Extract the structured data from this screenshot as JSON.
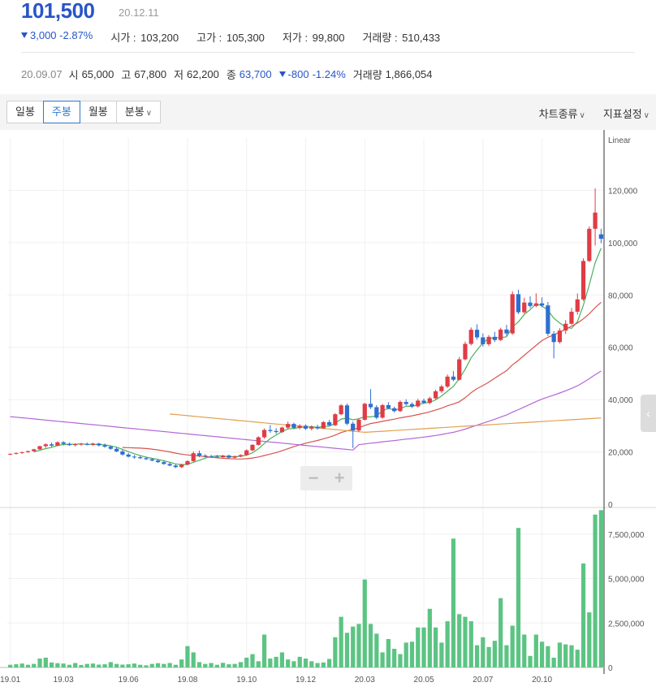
{
  "header": {
    "price": "101,500",
    "date": "20.12.11",
    "change": "3,000",
    "change_pct": "-2.87%",
    "open_label": "시가",
    "open": "103,200",
    "high_label": "고가",
    "high": "105,300",
    "low_label": "저가",
    "low": "99,800",
    "volume_label": "거래량",
    "volume": "510,433"
  },
  "hover": {
    "date": "20.09.07",
    "open_label": "시",
    "open": "65,000",
    "high_label": "고",
    "high": "67,800",
    "low_label": "저",
    "low": "62,200",
    "close_label": "종",
    "close": "63,700",
    "change": "-800",
    "change_pct": "-1.24%",
    "volume_label": "거래량",
    "volume": "1,866,054"
  },
  "toolbar": {
    "tabs": [
      "일봉",
      "주봉",
      "월봉",
      "분봉"
    ],
    "active_tab": "주봉",
    "chart_type_label": "차트종류",
    "indicator_label": "지표설정"
  },
  "colors": {
    "up": "#e03c45",
    "down": "#2e6fd0",
    "volume": "#5cc483",
    "ma5": "#4cb05a",
    "ma20": "#d9534f",
    "ma60": "#b466d6",
    "ma120": "#e0a050",
    "price_blue": "#2855c7"
  },
  "chart_data": {
    "type": "candlestick",
    "scale_label": "Linear",
    "price_axis": {
      "ticks": [
        "120,000",
        "100,000",
        "80,000",
        "60,000",
        "40,000",
        "20,000",
        "0"
      ],
      "ylim": [
        0,
        140000
      ]
    },
    "volume_axis": {
      "ticks": [
        "7,500,000",
        "5,000,000",
        "2,500,000",
        "0"
      ],
      "ylim": [
        0,
        9000000
      ]
    },
    "x_ticks": [
      "19.01",
      "19.03",
      "19.06",
      "19.08",
      "19.10",
      "19.12",
      "20.03",
      "20.05",
      "20.07",
      "20.10"
    ],
    "x_tick_index": [
      0,
      9,
      20,
      30,
      40,
      50,
      60,
      70,
      80,
      90
    ],
    "weeks": 101,
    "candles": [
      [
        19000,
        19400,
        18800,
        19300
      ],
      [
        19300,
        19800,
        19000,
        19600
      ],
      [
        19600,
        20100,
        19300,
        19900
      ],
      [
        19900,
        20500,
        19700,
        20300
      ],
      [
        20300,
        21200,
        20000,
        21000
      ],
      [
        21000,
        22400,
        20800,
        22200
      ],
      [
        22200,
        23300,
        21600,
        22900
      ],
      [
        22900,
        23600,
        21900,
        22400
      ],
      [
        22400,
        24000,
        22200,
        23700
      ],
      [
        23700,
        24100,
        22500,
        23100
      ],
      [
        23100,
        23600,
        22300,
        22600
      ],
      [
        22600,
        23300,
        22100,
        22900
      ],
      [
        22900,
        23500,
        22400,
        23100
      ],
      [
        23100,
        23600,
        22500,
        22700
      ],
      [
        22700,
        23500,
        22300,
        23200
      ],
      [
        23200,
        23500,
        22100,
        22500
      ],
      [
        22500,
        23200,
        21600,
        22000
      ],
      [
        22000,
        22500,
        20800,
        21200
      ],
      [
        21200,
        21800,
        19900,
        20200
      ],
      [
        20200,
        20800,
        18600,
        19000
      ],
      [
        19000,
        19600,
        17900,
        18200
      ],
      [
        18200,
        18800,
        17400,
        18000
      ],
      [
        18000,
        18600,
        17300,
        17600
      ],
      [
        17600,
        18100,
        16900,
        17200
      ],
      [
        17200,
        17700,
        16400,
        16700
      ],
      [
        16700,
        17300,
        15800,
        16100
      ],
      [
        16100,
        16700,
        15100,
        15400
      ],
      [
        15400,
        16000,
        14500,
        14800
      ],
      [
        14800,
        15200,
        13800,
        14200
      ],
      [
        14200,
        15500,
        13800,
        15200
      ],
      [
        15200,
        16800,
        14900,
        16500
      ],
      [
        16500,
        20200,
        16200,
        19500
      ],
      [
        19500,
        20500,
        18000,
        18600
      ],
      [
        18600,
        19200,
        17900,
        18300
      ],
      [
        18300,
        18900,
        17800,
        18200
      ],
      [
        18200,
        18800,
        17700,
        18000
      ],
      [
        18000,
        18900,
        17700,
        18600
      ],
      [
        18600,
        19000,
        17500,
        17800
      ],
      [
        17800,
        18600,
        17400,
        18300
      ],
      [
        18300,
        19100,
        18000,
        18800
      ],
      [
        18800,
        21000,
        18500,
        20600
      ],
      [
        20600,
        23000,
        20300,
        22700
      ],
      [
        22700,
        26000,
        22400,
        25600
      ],
      [
        25600,
        29000,
        25000,
        28400
      ],
      [
        28400,
        30300,
        27300,
        28000
      ],
      [
        28000,
        29100,
        26900,
        27600
      ],
      [
        27600,
        29700,
        27200,
        29300
      ],
      [
        29300,
        31600,
        28600,
        30700
      ],
      [
        30700,
        31200,
        28700,
        29200
      ],
      [
        29200,
        30600,
        28600,
        30000
      ],
      [
        30000,
        30500,
        28400,
        28900
      ],
      [
        28900,
        30100,
        28200,
        29600
      ],
      [
        29600,
        30400,
        28500,
        29000
      ],
      [
        29000,
        31800,
        28800,
        31400
      ],
      [
        31400,
        32200,
        29900,
        30200
      ],
      [
        30200,
        34800,
        29900,
        34400
      ],
      [
        34400,
        38300,
        34000,
        37800
      ],
      [
        37800,
        38500,
        30200,
        30800
      ],
      [
        30800,
        31600,
        21500,
        28200
      ],
      [
        28200,
        32900,
        27600,
        32300
      ],
      [
        32300,
        38800,
        32000,
        38400
      ],
      [
        38400,
        44000,
        36400,
        37100
      ],
      [
        37100,
        37900,
        32500,
        33100
      ],
      [
        33100,
        38400,
        32700,
        37900
      ],
      [
        37900,
        39000,
        36300,
        36700
      ],
      [
        36700,
        37300,
        35100,
        35600
      ],
      [
        35600,
        39700,
        35200,
        39100
      ],
      [
        39100,
        40100,
        37800,
        38300
      ],
      [
        38300,
        38900,
        36800,
        37400
      ],
      [
        37400,
        40300,
        37000,
        39600
      ],
      [
        39600,
        40400,
        38400,
        38800
      ],
      [
        38800,
        41100,
        38200,
        40500
      ],
      [
        40500,
        43800,
        40100,
        43200
      ],
      [
        43200,
        45700,
        42500,
        45000
      ],
      [
        45000,
        49600,
        44400,
        48800
      ],
      [
        48800,
        50900,
        47000,
        47600
      ],
      [
        47600,
        56300,
        47300,
        55400
      ],
      [
        55400,
        62200,
        55000,
        61300
      ],
      [
        61300,
        67600,
        60700,
        66700
      ],
      [
        66700,
        68800,
        62900,
        63800
      ],
      [
        63800,
        65300,
        60300,
        61200
      ],
      [
        61200,
        64700,
        60500,
        64000
      ],
      [
        64000,
        65900,
        62100,
        62800
      ],
      [
        62800,
        67500,
        62400,
        66800
      ],
      [
        66800,
        68600,
        64400,
        65300
      ],
      [
        65300,
        81400,
        64800,
        80300
      ],
      [
        80300,
        82000,
        72700,
        73400
      ],
      [
        73400,
        78900,
        72900,
        77100
      ],
      [
        77100,
        79500,
        75000,
        75800
      ],
      [
        75800,
        80600,
        75300,
        76800
      ],
      [
        76800,
        79100,
        75300,
        76000
      ],
      [
        76000,
        77300,
        64300,
        65200
      ],
      [
        65200,
        66200,
        55800,
        62000
      ],
      [
        62000,
        67300,
        61400,
        66400
      ],
      [
        66400,
        70400,
        65100,
        69000
      ],
      [
        69000,
        75000,
        68600,
        73600
      ],
      [
        73600,
        80600,
        72500,
        78300
      ],
      [
        78300,
        94000,
        77700,
        93000
      ],
      [
        93000,
        106200,
        92600,
        105300
      ],
      [
        105300,
        120800,
        98900,
        111500
      ],
      [
        103200,
        105300,
        99800,
        101500
      ]
    ],
    "volume": [
      0.15,
      0.18,
      0.22,
      0.15,
      0.2,
      0.5,
      0.55,
      0.28,
      0.24,
      0.22,
      0.15,
      0.25,
      0.14,
      0.2,
      0.22,
      0.16,
      0.18,
      0.3,
      0.2,
      0.16,
      0.18,
      0.22,
      0.15,
      0.12,
      0.2,
      0.24,
      0.2,
      0.25,
      0.15,
      0.45,
      1.2,
      0.85,
      0.3,
      0.2,
      0.25,
      0.15,
      0.26,
      0.18,
      0.2,
      0.3,
      0.55,
      0.75,
      0.35,
      1.85,
      0.5,
      0.6,
      0.85,
      0.45,
      0.35,
      0.6,
      0.5,
      0.35,
      0.25,
      0.28,
      0.48,
      1.7,
      2.85,
      1.95,
      2.3,
      2.45,
      4.95,
      2.45,
      1.9,
      0.85,
      1.6,
      1.05,
      0.75,
      1.4,
      1.45,
      2.25,
      2.25,
      3.3,
      2.25,
      1.4,
      2.6,
      7.25,
      3.0,
      2.85,
      2.6,
      1.25,
      1.7,
      1.15,
      1.5,
      3.9,
      1.25,
      2.35,
      7.85,
      1.85,
      0.65,
      1.85,
      1.45,
      1.2,
      0.55,
      1.4,
      1.3,
      1.25,
      1.0,
      5.85,
      3.1,
      8.6,
      8.85
    ]
  }
}
